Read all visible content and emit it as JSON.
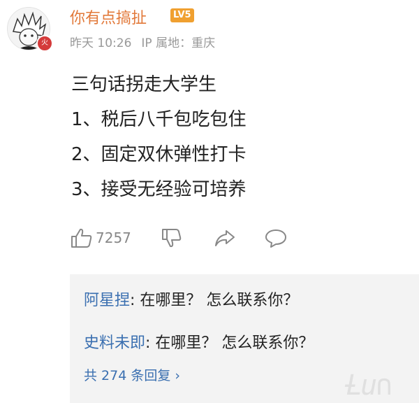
{
  "post": {
    "username": "你有点搞扯",
    "level_badge": "LV5",
    "badge_char": "火",
    "time": "昨天 10:26",
    "ip_location": "IP 属地：重庆",
    "lines": [
      "三句话拐走大学生",
      "1、税后八千包吃包住",
      "2、固定双休弹性打卡",
      "3、接受无经验可培养"
    ]
  },
  "actions": {
    "like_count": "7257",
    "icons": [
      "thumb-up-icon",
      "thumb-down-icon",
      "share-icon",
      "comment-icon"
    ]
  },
  "replies": {
    "items": [
      {
        "author": "阿星捏",
        "text": ": 在哪里？ 怎么联系你？"
      },
      {
        "author": "史料未即",
        "text": ": 在哪里？ 怎么联系你？"
      }
    ],
    "total": "共 274 条回复",
    "chevron": "›"
  },
  "watermark": "Ƚu∩",
  "colors": {
    "username": "#e2793a",
    "reply_author": "#3a6fb0",
    "level_badge": "#f0a030"
  }
}
